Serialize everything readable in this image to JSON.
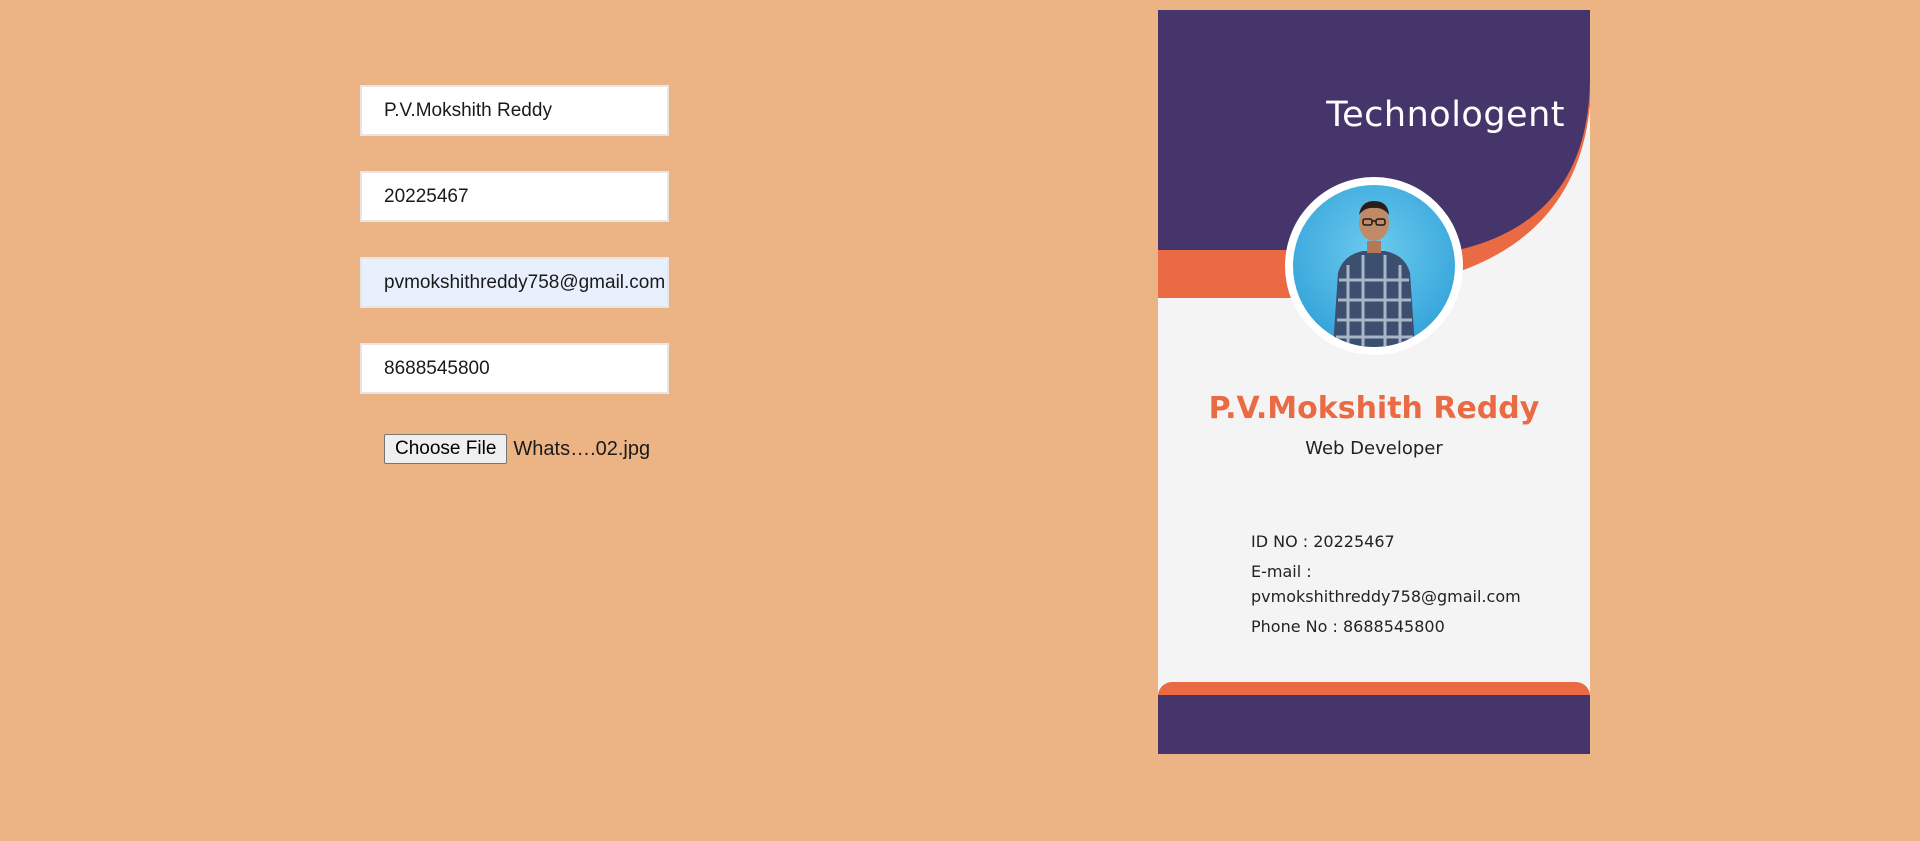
{
  "form": {
    "name_value": "P.V.Mokshith Reddy",
    "id_value": "20225467",
    "email_value": "pvmokshithreddy758@gmail.com",
    "phone_value": "8688545800",
    "file_button_label": "Choose File",
    "file_name": "Whats….02.jpg"
  },
  "card": {
    "brand": "Technologent",
    "name": "P.V.Mokshith Reddy",
    "role": "Web Developer",
    "id_line": "ID NO : 20225467",
    "email_label": "E-mail :",
    "email_value": "pvmokshithreddy758@gmail.com",
    "phone_line": "Phone No : 8688545800"
  },
  "colors": {
    "page_background": "#ecb385",
    "card_primary": "#46356b",
    "card_accent": "#ea6a44",
    "card_background": "#f4f4f4"
  }
}
